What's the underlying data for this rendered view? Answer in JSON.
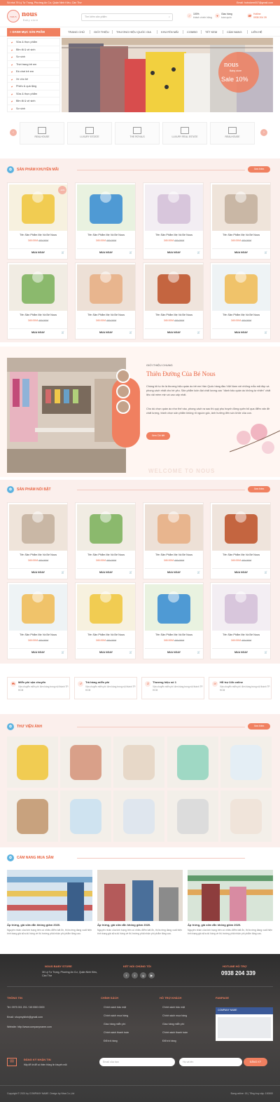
{
  "topbar": {
    "address": "Số nhà 79 Lý Tự Trọng, Phường An Cư, Quận Ninh Kiều, Cần Thơ",
    "email": "Email: hotrokem007@gmail.com"
  },
  "header": {
    "logo_badge": "NOUS",
    "logo": "nous",
    "logo_sub": "Baby store",
    "search_placeholder": "Tìm kiếm sản phẩm",
    "info": [
      {
        "icon": "shield-icon",
        "line1": "100%",
        "line2": "khách chính hãng"
      },
      {
        "icon": "heart-icon",
        "line1": "Giao hàng",
        "line2": "toàn quốc"
      },
      {
        "icon": "phone-icon",
        "line1": "Hotline",
        "line2": "0938 204 39"
      }
    ]
  },
  "nav": {
    "category_button": "DANH MỤC SẢN PHẨM",
    "items": [
      "TRANG CHỦ",
      "GIỚI THIỆU",
      "THƯƠNG HIỆU QUỐC GIA",
      "KHUYẾN MÃI",
      "COMBO",
      "TẾT KEM",
      "CẨM NANG",
      "LIÊN HỆ"
    ]
  },
  "sidebar": [
    "Sữa & thực phẩm",
    "Bỉm tã & vệ sinh",
    "Sơ sinh",
    "Thời trang trẻ em",
    "Đồ chơi trẻ em",
    "Xe cho bé",
    "Phiếu & quà tặng",
    "Sữa & thực phẩm",
    "Bỉm tã & vệ sinh",
    "Sơ sinh"
  ],
  "banner": {
    "brand": "nous",
    "brand_sub": "Baby store",
    "sale": "Sale 10%"
  },
  "partners": [
    "REALHOUSE",
    "LUXURY ESTATE",
    "THE ROYALS",
    "LUXURY REAL ESTATE",
    "REALHOUSE"
  ],
  "promo": {
    "title": "SẢN PHẨM KHUYẾN MÃI",
    "more": "Xem thêm",
    "product_name": "Tên Sản Phẩm Mẹ Và Bé Nous",
    "price_new": "345.000đ",
    "price_old": "400.000đ",
    "buy": "MUA NGAY",
    "discount_badge": "-10%"
  },
  "about": {
    "label": "GIỚI THIỆU CHUNG",
    "title": "Thiên Đường Của Bé Nous",
    "p1": "Chúng tôi tự tin là thương hiệu quần áo trẻ em Hàn Quốc hàng đầu Việt Nam với những mẫu mã đẹp và phong cách nhất cho bé yêu. Sản phẩm luôn đạt chất lượng cao \"dành bảo quần áo không tự nhiên\" chất liệu vải mềm mịn và cao cấp nhất.",
    "p2": "Cho dù chọn quần áo như thế nào, phong cách ra sao thì quý phụ huynh đừng quên bỏ qua điểm vấn đề chất lượng, tránh chọn sản phẩm không rõ nguồn gốc, ảnh hưởng đến sức khỏe của con.",
    "button": "Xem Chi tiết",
    "welcome": "WELCOME TO NOUS"
  },
  "featured": {
    "title": "SẢN PHẨM NỔI BẬT",
    "more": "Xem thêm"
  },
  "policies": [
    {
      "title": "Miễn phí vận chuyển",
      "desc": "Vận chuyển miễn phí đơn hàng trong nội thành TP. HCM"
    },
    {
      "title": "Trả hàng miễn phí",
      "desc": "Vận chuyển miễn phí đơn hàng trong nội thành TP. HCM"
    },
    {
      "title": "Thương hiệu số 1",
      "desc": "Vận chuyển miễn phí đơn hàng trong nội thành TP. HCM"
    },
    {
      "title": "Hỗ trợ 24h online",
      "desc": "Vận chuyển miễn phí đơn hàng trong nội thành TP. HCM"
    }
  ],
  "gallery": {
    "title": "THƯ VIỆN ẢNH",
    "more": "Xem thêm"
  },
  "handbook": {
    "title": "CẨM NANG MUA SẮM",
    "posts": [
      {
        "title": "Ấp trứng, giá sữa vẫn không giảm 2020.",
        "desc": "Nguyên nhân của tình trạng trên có nhiều điểm bất ổn, thị trường đang xuất hiện tình trạng giá sữa dù hàng về thị trường phải nhận phí phẩm tăng cao."
      },
      {
        "title": "Ấp trứng, giá sữa vẫn không giảm 2020.",
        "desc": "Nguyên nhân của tình trạng trên có nhiều điểm bất ổn, thị trường đang xuất hiện tình trạng giá sữa dù hàng về thị trường phải nhận phí phẩm tăng cao."
      },
      {
        "title": "Ấp trứng, giá sữa vẫn không giảm 2020.",
        "desc": "Nguyên nhân của tình trạng trên có nhiều điểm bất ổn, thị trường đang xuất hiện tình trạng giá sữa dù hàng về thị trường phải nhận phí phẩm tăng cao."
      }
    ]
  },
  "footer": {
    "store_name": "NOUS BABY STORE",
    "store_addr": "30 Lý Tự Trọng, Phường An Cư, Quận Ninh Kiều, Cần Thơ",
    "connect": "KẾT NỐI CHÚNG TÔI",
    "hotline_label": "HOTLINE HỖ TRỢ",
    "hotline": "0938 204 339",
    "info_title": "THÔNG TIN",
    "info": [
      "Tel: 0975 001 201 / 08 0000 0000",
      "Email: shopmyklinh@gmail.com",
      "Website: http://www.companyname.com"
    ],
    "policy_title": "CHÍNH SÁCH",
    "policy": [
      "Chính sách bảo mật",
      "Chính sách mua hàng",
      "Giao hàng miễn phí",
      "Chính sách thanh toán",
      "Đổi trả hàng"
    ],
    "support_title": "HỖ TRỢ KHÁCH",
    "support": [
      "Chính sách bảo mật",
      "Chính sách mua hàng",
      "Giao hàng miễn phí",
      "Chính sách thanh toán",
      "Đổi trả hàng"
    ],
    "fanpage_title": "FANPAGE",
    "fanpage_name": "COMPANY NAME",
    "newsletter_title": "ĐĂNG KÝ NHẬN TIN",
    "newsletter_sub": "Hãy để lời để có thêm thông tin khuyến mãi",
    "email_placeholder": "Email của bạn",
    "name_placeholder": "Họ và tên",
    "subscribe": "ĐĂNG KÝ",
    "copyright": "Copyright © 2021 by COMPANY NAME. Design by Nina Co.,Ltd",
    "stats": "Đang online: 15 | Tổng truy cập: 100000"
  }
}
